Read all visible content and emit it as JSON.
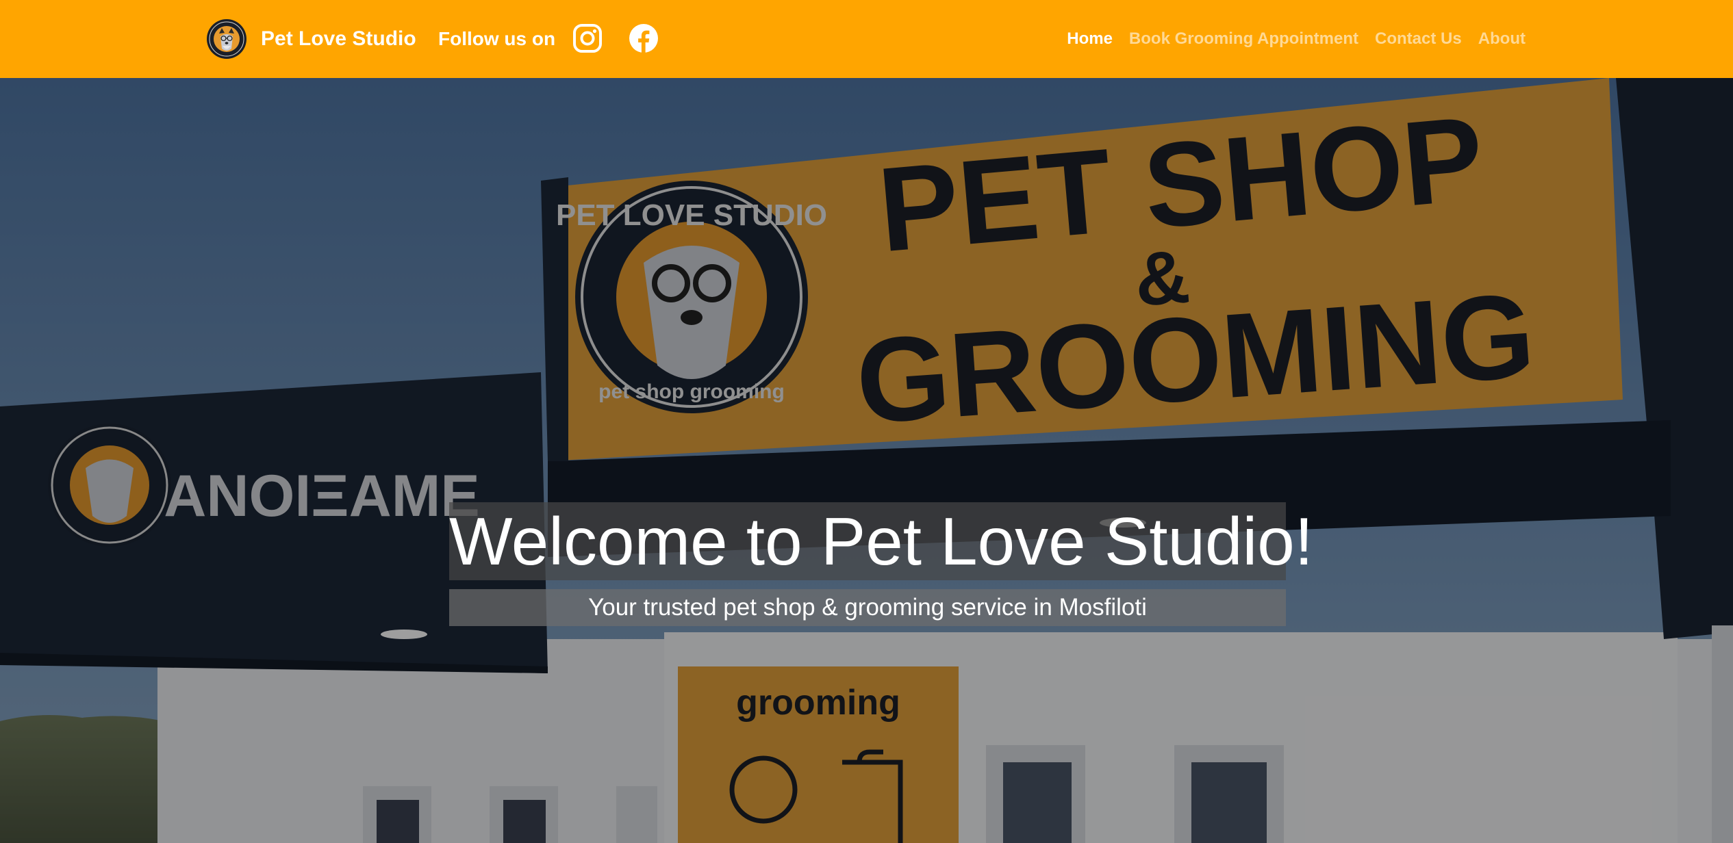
{
  "navbar": {
    "brand_name": "Pet Love Studio",
    "follow_text": "Follow us on",
    "social": [
      {
        "icon": "instagram-icon"
      },
      {
        "icon": "facebook-icon"
      }
    ],
    "links": [
      {
        "label": "Home",
        "active": true
      },
      {
        "label": "Book Grooming Appointment",
        "active": false
      },
      {
        "label": "Contact Us",
        "active": false
      },
      {
        "label": "About",
        "active": false
      }
    ],
    "colors": {
      "background": "#ffa500",
      "active_link": "#ffffff",
      "inactive_link": "rgba(255,255,255,0.58)"
    }
  },
  "hero": {
    "heading": "Welcome to Pet Love Studio!",
    "subheading": "Your trusted pet shop & grooming service in Mosfiloti",
    "photo": {
      "banner_line1": "PET SHOP",
      "banner_line2": "&",
      "banner_line3": "GROOMING",
      "logo_ring_top": "PET LOVE STUDIO",
      "logo_ring_bottom": "pet shop grooming",
      "side_sign": "ΑΝΟΙΞΑΜΕ",
      "poster_text": "grooming"
    },
    "colors": {
      "banner": "#e3a03a",
      "awning": "#1c2738",
      "sky": "#5d7ea6"
    }
  }
}
